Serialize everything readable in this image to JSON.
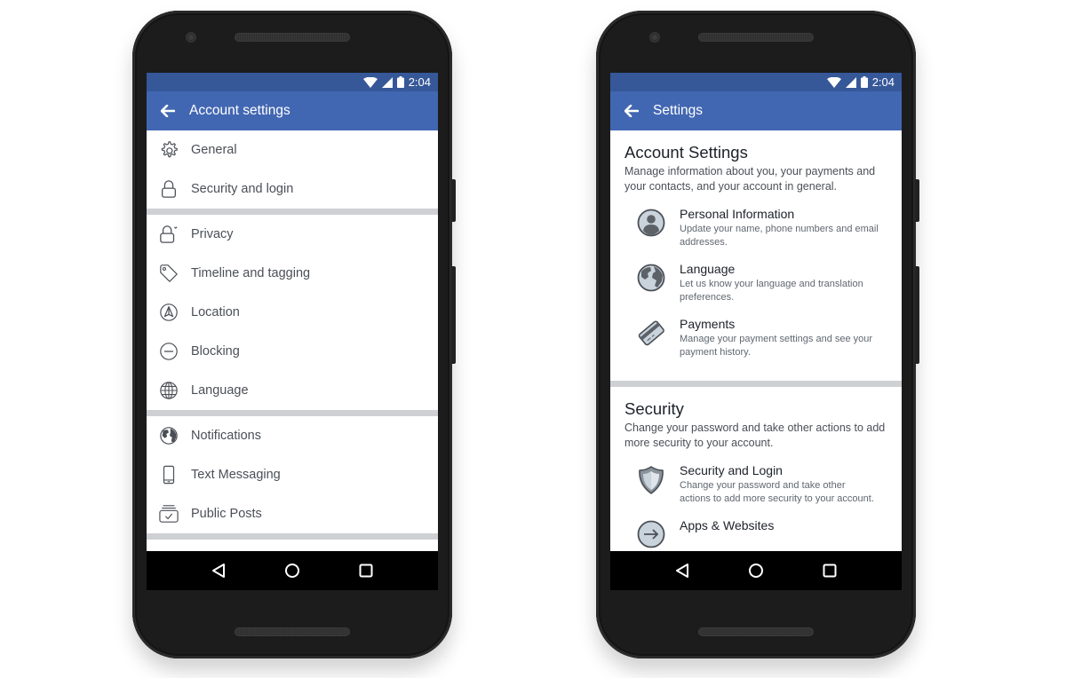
{
  "colors": {
    "status_bar": "#365899",
    "app_bar": "#4267b2",
    "separator": "#ced0d4",
    "text_primary": "#1d2129",
    "text_secondary": "#4b4f56"
  },
  "left_phone": {
    "status": {
      "time": "2:04",
      "icons": [
        "wifi-icon",
        "signal-icon",
        "battery-icon"
      ]
    },
    "appbar": {
      "back_icon": "arrow-left-icon",
      "title": "Account settings"
    },
    "groups": [
      [
        {
          "icon": "gear-icon",
          "label": "General"
        },
        {
          "icon": "lock-icon",
          "label": "Security and login"
        }
      ],
      [
        {
          "icon": "privacy-lock-icon",
          "label": "Privacy"
        },
        {
          "icon": "tag-icon",
          "label": "Timeline and tagging"
        },
        {
          "icon": "location-icon",
          "label": "Location"
        },
        {
          "icon": "blocking-icon",
          "label": "Blocking"
        },
        {
          "icon": "globe-icon",
          "label": "Language"
        }
      ],
      [
        {
          "icon": "globe-filled-icon",
          "label": "Notifications"
        },
        {
          "icon": "phone-icon",
          "label": "Text Messaging"
        },
        {
          "icon": "public-posts-icon",
          "label": "Public Posts"
        }
      ]
    ],
    "navbar": [
      "back-nav-icon",
      "home-nav-icon",
      "recents-nav-icon"
    ]
  },
  "right_phone": {
    "status": {
      "time": "2:04",
      "icons": [
        "wifi-icon",
        "signal-icon",
        "battery-icon"
      ]
    },
    "appbar": {
      "back_icon": "arrow-left-icon",
      "title": "Settings"
    },
    "sections": [
      {
        "title": "Account Settings",
        "description": "Manage information about you, your payments and your contacts, and your account in general.",
        "items": [
          {
            "icon": "person-icon",
            "title": "Personal Information",
            "description": "Update your name, phone numbers and email addresses."
          },
          {
            "icon": "globe-icon",
            "title": "Language",
            "description": "Let us know your language and translation preferences."
          },
          {
            "icon": "credit-card-icon",
            "title": "Payments",
            "description": "Manage your payment settings and see your payment history."
          }
        ]
      },
      {
        "title": "Security",
        "description": "Change your password and take other actions to add more security to your account.",
        "items": [
          {
            "icon": "shield-icon",
            "title": "Security and Login",
            "description": "Change your password and take other actions to add more security to your account."
          },
          {
            "icon": "arrow-circle-icon",
            "title": "Apps & Websites",
            "description": ""
          }
        ]
      }
    ],
    "navbar": [
      "back-nav-icon",
      "home-nav-icon",
      "recents-nav-icon"
    ]
  }
}
